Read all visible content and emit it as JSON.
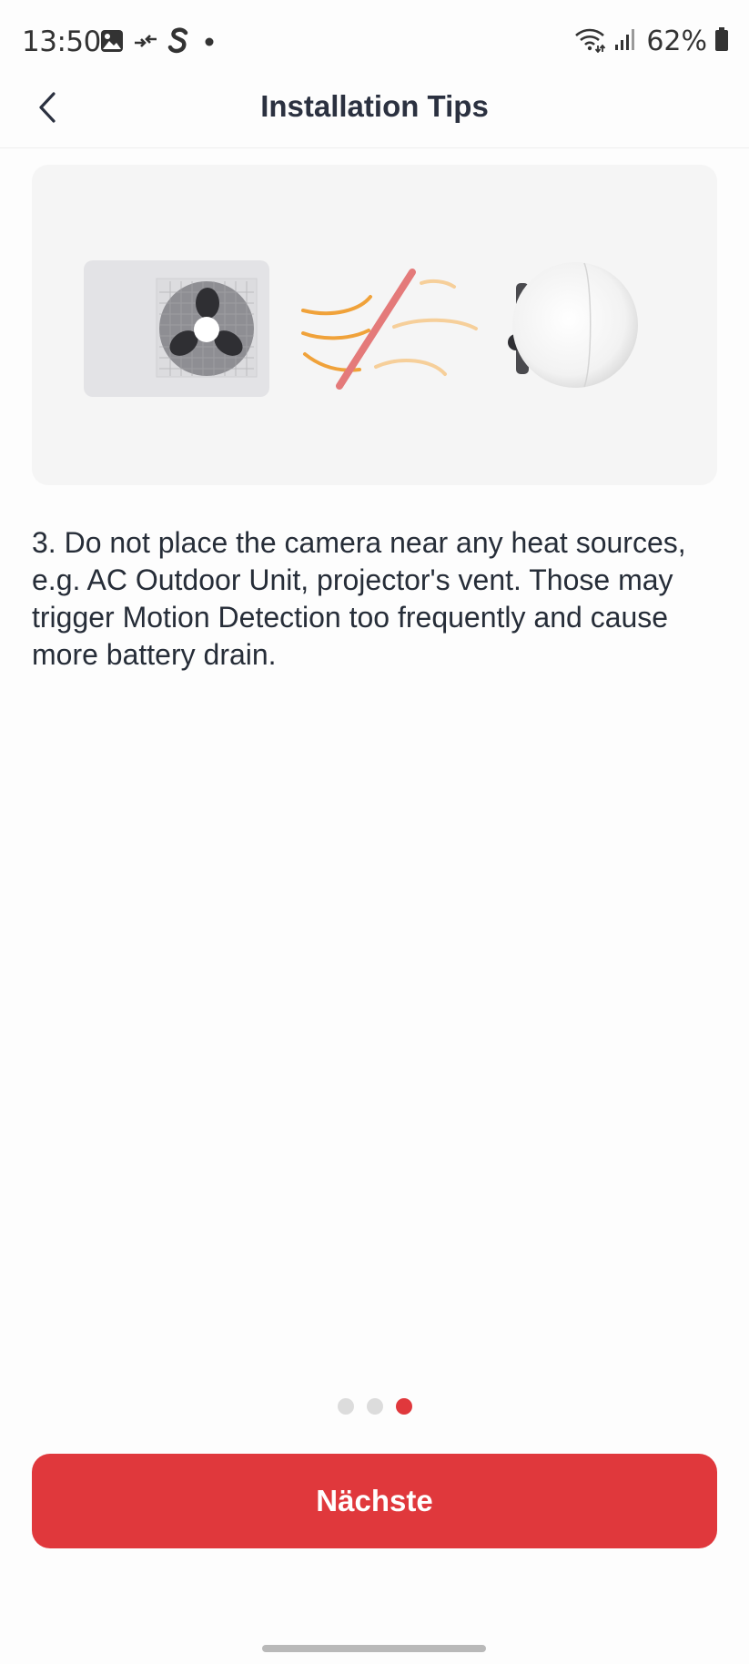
{
  "status_bar": {
    "time": "13:50",
    "battery_percent": "62%",
    "left_icons": [
      "gallery-icon",
      "data-transfer-icon",
      "s-app-icon",
      "notification-dot-icon"
    ],
    "right_icons": [
      "wifi-icon",
      "signal-icon",
      "battery-icon"
    ]
  },
  "header": {
    "title": "Installation Tips",
    "back_icon": "chevron-left-icon"
  },
  "illustration": {
    "elements": [
      "ac-outdoor-unit",
      "heat-waves",
      "blocked-slash",
      "camera"
    ]
  },
  "tip": {
    "text": "3. Do not place the camera near any heat sources, e.g. AC Outdoor Unit, projector's vent. Those may trigger Motion Detection too frequently and cause more battery drain."
  },
  "pagination": {
    "total": 3,
    "current": 3
  },
  "next_button": {
    "label": "Nächste"
  },
  "colors": {
    "accent": "#e0383c",
    "card_background": "#f5f5f5",
    "text": "#262d38",
    "dot_inactive": "#dcdcdc"
  }
}
